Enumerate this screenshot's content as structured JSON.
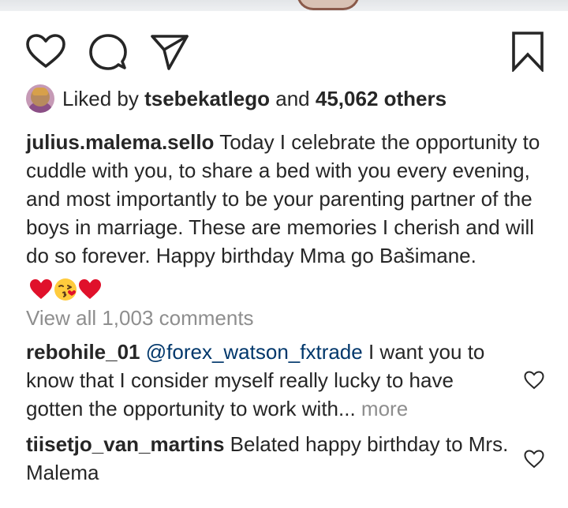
{
  "post": {
    "icons": {
      "like": "heart-icon",
      "comment": "comment-bubble-icon",
      "share": "paper-plane-icon",
      "save": "bookmark-icon"
    },
    "likes": {
      "prefix": "Liked by",
      "liker": "tsebekatlego",
      "conjunction": "and",
      "others": "45,062 others"
    },
    "caption": {
      "username": "julius.malema.sello",
      "text": "Today I celebrate the opportunity to cuddle with you, to share a bed with you every evening, and most importantly to be your parenting partner of the boys in marriage. These are memories I cherish and will do so forever. Happy birthday Mma go Bašimane.",
      "emojis": [
        "red-heart",
        "face-blowing-kiss",
        "red-heart"
      ]
    },
    "view_all_comments": "View all 1,003 comments",
    "comments": [
      {
        "username": "rebohile_01",
        "mention": "@forex_watson_fxtrade",
        "text": "I want you to know that I consider myself really lucky to have gotten the opportunity to work with...",
        "more": "more"
      },
      {
        "username": "tiisetjo_van_martins",
        "text": "Belated happy birthday to Mrs. Malema"
      }
    ]
  },
  "colors": {
    "text": "#262626",
    "muted": "#8e8e8e",
    "mention": "#00376b",
    "heart_red": "#e0112b"
  }
}
